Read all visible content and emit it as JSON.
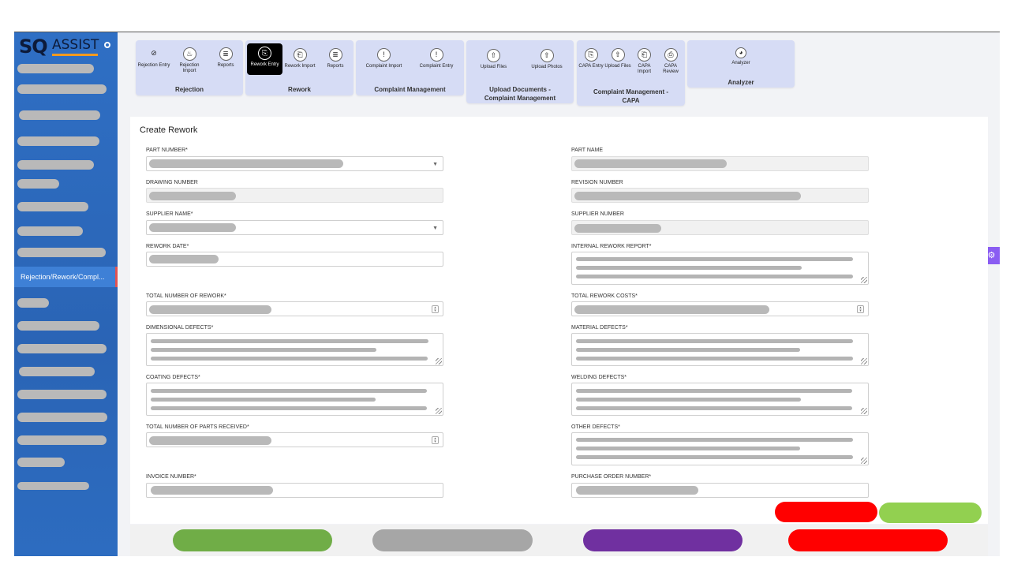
{
  "app": {
    "logo_sq": "SQ",
    "logo_assist": "ASSIST"
  },
  "sidebar": {
    "active_item": "Rejection/Rework/Compl..."
  },
  "toolbar": {
    "groups": [
      {
        "title": "Rejection",
        "tools": [
          {
            "label": "Rejection Entry",
            "icon": "ban-icon"
          },
          {
            "label": "Rejection Import",
            "icon": "fire-icon"
          },
          {
            "label": "Reports",
            "icon": "document-icon"
          }
        ]
      },
      {
        "title": "Rework",
        "tools": [
          {
            "label": "Rework Entry",
            "icon": "rework-entry-icon",
            "active": true
          },
          {
            "label": "Rework Import",
            "icon": "rework-import-icon"
          },
          {
            "label": "Reports",
            "icon": "document-icon"
          }
        ]
      },
      {
        "title": "Complaint Management",
        "tools": [
          {
            "label": "Complaint Import",
            "icon": "complaint-import-icon"
          },
          {
            "label": "Complaint Entry",
            "icon": "complaint-entry-icon"
          }
        ]
      },
      {
        "title": "Upload Documents - Complaint Management",
        "tools": [
          {
            "label": "Upload Files",
            "icon": "cloud-upload-icon"
          },
          {
            "label": "Upload Photos",
            "icon": "cloud-upload-icon"
          }
        ]
      },
      {
        "title": "Complaint Management - CAPA",
        "tools": [
          {
            "label": "CAPA Entry",
            "icon": "capa-entry-icon"
          },
          {
            "label": "Upload Files",
            "icon": "cloud-upload-icon"
          },
          {
            "label": "CAPA Import",
            "icon": "capa-import-icon"
          },
          {
            "label": "CAPA Review",
            "icon": "capa-review-icon"
          }
        ]
      },
      {
        "title": "Analyzer",
        "tools": [
          {
            "label": "Analyzer",
            "icon": "analyzer-icon"
          }
        ]
      }
    ]
  },
  "form": {
    "title": "Create Rework",
    "labels": {
      "part_number": "PART NUMBER*",
      "part_name": "PART NAME",
      "drawing_number": "DRAWING NUMBER",
      "revision_number": "REVISION NUMBER",
      "supplier_name": "SUPPLIER NAME*",
      "supplier_number": "SUPPLIER NUMBER",
      "rework_date": "REWORK DATE*",
      "internal_rework_report": "INTERNAL REWORK REPORT*",
      "total_number_of_rework": "TOTAL NUMBER OF REWORK*",
      "total_rework_costs": "TOTAL REWORK COSTS*",
      "dimensional_defects": "DIMENSIONAL DEFECTS*",
      "material_defects": "MATERIAL DEFECTS*",
      "coating_defects": "COATING DEFECTS*",
      "welding_defects": "WELDING DEFECTS*",
      "total_number_of_parts_received": "TOTAL NUMBER OF PARTS RECEIVED*",
      "other_defects": "OTHER DEFECTS*",
      "invoice_number": "INVOICE NUMBER*",
      "purchase_order_number": "PURCHASE ORDER NUMBER*"
    }
  },
  "colors": {
    "sidebar": "#2d6cc0",
    "toolbar_group": "#d6dcf5",
    "button_red": "#ff0000",
    "button_light_green": "#92d050",
    "button_green": "#70ad47",
    "button_gray": "#a6a6a6",
    "button_purple": "#7030a0",
    "settings_tab": "#8a5cf2"
  }
}
